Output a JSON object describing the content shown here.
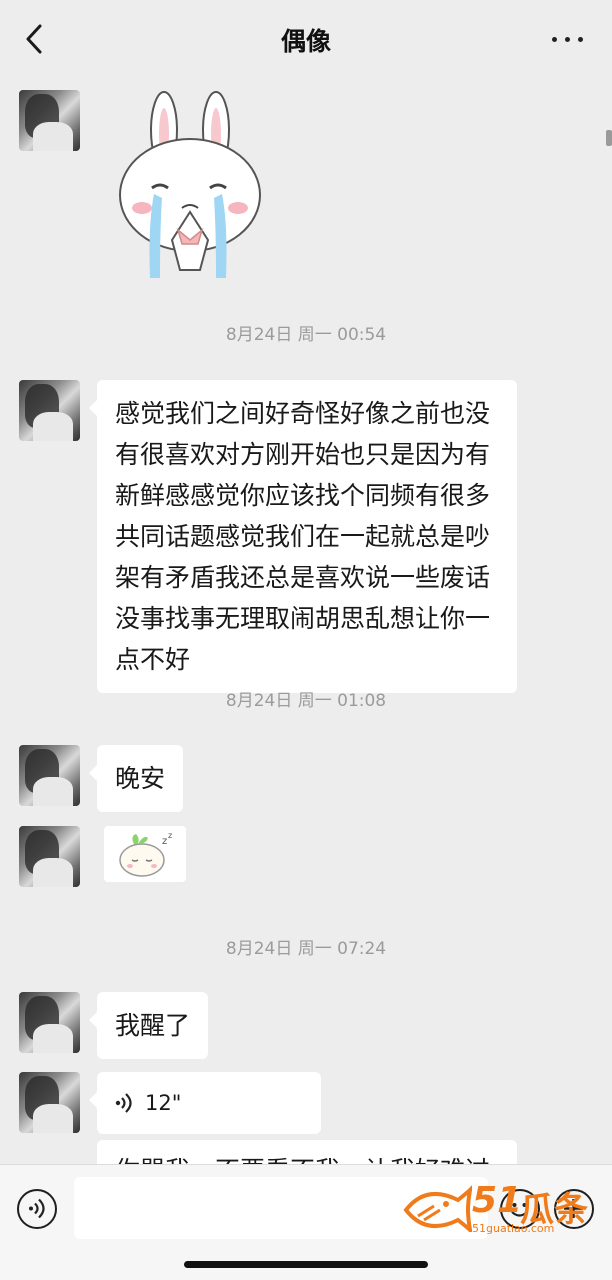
{
  "nav": {
    "title": "偶像",
    "back_icon": "chevron-left-icon",
    "more_icon": "more-dots-icon"
  },
  "messages": {
    "timestamps": [
      "8月24日 周一 00:54",
      "8月24日 周一 01:08",
      "8月24日 周一 07:24"
    ],
    "long_text_lines": [
      "感觉我们之间好奇怪好像之前也没",
      "有很喜欢对方刚开始也只是因为有",
      "新鲜感感觉你应该找个同频有很多",
      "共同话题感觉我们在一起就总是吵",
      "架有矛盾我还总是喜欢说一些废话",
      "没事找事无理取闹胡思乱想让你一",
      "点不好"
    ],
    "goodnight": "晚安",
    "awake": "我醒了",
    "voice_duration": "12\"",
    "partial_text": "你骂我，不要看不我，让我好难过"
  },
  "stickers": {
    "rabbit": "crying-rabbit-sticker",
    "sleeping": "sleeping-bun-sticker",
    "sleeping_text": "z"
  },
  "input": {
    "voice_icon": "voice-mode-icon",
    "emoji_icon": "emoji-icon",
    "plus_icon": "plus-icon",
    "placeholder": ""
  },
  "watermark": {
    "number": "51",
    "chinese": "瓜条",
    "url": "51guatiao.com"
  },
  "colors": {
    "background": "#ededed",
    "bubble": "#ffffff",
    "watermark": "#f07b1a"
  }
}
